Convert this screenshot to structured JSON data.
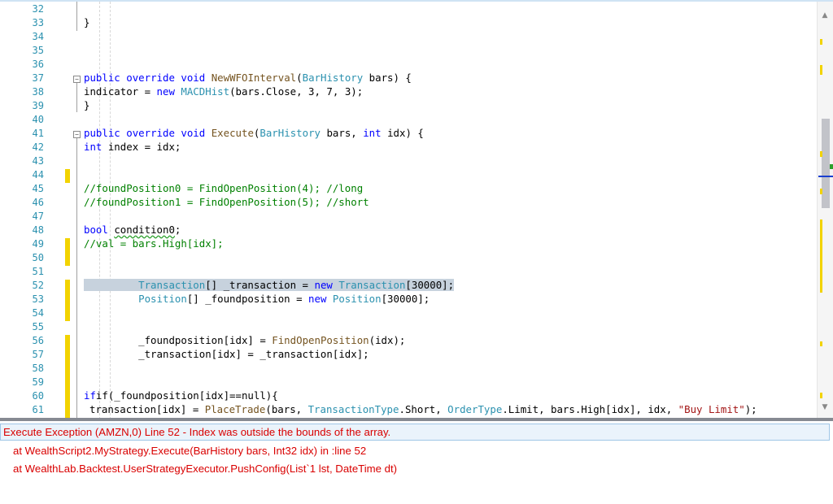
{
  "editor": {
    "line_numbers": [
      "32",
      "33",
      "34",
      "35",
      "36",
      "37",
      "38",
      "39",
      "40",
      "41",
      "42",
      "43",
      "44",
      "45",
      "46",
      "47",
      "48",
      "49",
      "50",
      "51",
      "52",
      "53",
      "54",
      "55",
      "56",
      "57",
      "58",
      "59",
      "60",
      "61"
    ],
    "code": {
      "l33": "}",
      "l37": {
        "a": "public",
        "b": "override",
        "c": "void",
        "d": "NewWFOInterval",
        "e": "(",
        "f": "BarHistory",
        "g": " bars) {"
      },
      "l38": {
        "a": "indicator = ",
        "b": "new",
        "c": "MACDHist",
        "d": "(bars.Close, 3, 7, 3);"
      },
      "l39": "}",
      "l41": {
        "a": "public",
        "b": "override",
        "c": "void",
        "d": "Execute",
        "e": "(",
        "f": "BarHistory",
        "g": " bars, ",
        "h": "int",
        "i": " idx) {"
      },
      "l42": {
        "a": "int",
        "b": " index = idx;"
      },
      "l45": "//foundPosition0 = FindOpenPosition(4); //long",
      "l46": "//foundPosition1 = FindOpenPosition(5); //short",
      "l48": {
        "a": "bool",
        "b": "condition0",
        "c": ";"
      },
      "l49": "//val = bars.High[idx];",
      "l52": {
        "a": "Transaction",
        "b": "[] _transaction = ",
        "c": "new",
        "d": "Transaction",
        "e": "[30000];"
      },
      "l53": {
        "a": "Position",
        "b": "[] _foundposition = ",
        "c": "new",
        "d": "Position",
        "e": "[30000];"
      },
      "l56": {
        "a": "_foundposition[idx] = ",
        "b": "FindOpenPosition",
        "c": "(idx);"
      },
      "l57": "_transaction[idx] = _transaction[idx];",
      "l60": "if(_foundposition[idx]==null){",
      "l61": {
        "a": "transaction[idx] = ",
        "b": "PlaceTrade",
        "c": "(bars, ",
        "d": "TransactionType",
        "e": ".Short, ",
        "f": "OrderType",
        "g": ".Limit, bars.High[idx], idx, ",
        "h": "\"Buy Limit\"",
        "i": ");"
      }
    }
  },
  "error_panel": {
    "header": "Execute Exception (AMZN,0) Line 52 - Index was outside the bounds of the array.",
    "trace": [
      "at WealthScript2.MyStrategy.Execute(BarHistory bars, Int32 idx) in :line 52",
      "at WealthLab.Backtest.UserStrategyExecutor.PushConfig(List`1 lst, DateTime dt)"
    ]
  },
  "icons": {
    "scroll_up": "▲",
    "scroll_down": "▼",
    "fold_minus": "−"
  },
  "colors": {
    "line_number": "#2b91af",
    "keyword": "#0000ff",
    "type": "#2b91af",
    "method": "#74531f",
    "comment": "#008000",
    "string": "#a31515",
    "change_bar": "#f2d300",
    "error": "#d90000"
  }
}
